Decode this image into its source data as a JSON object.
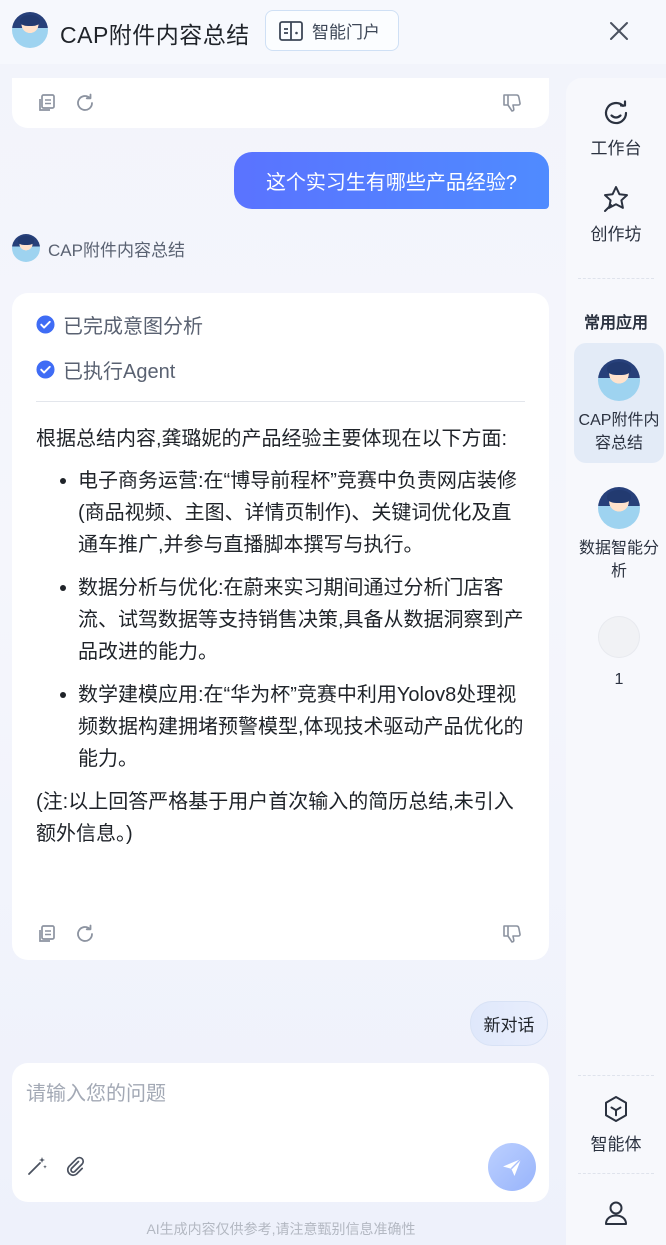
{
  "header": {
    "title": "CAP附件内容总结",
    "portal_label": "智能门户"
  },
  "sidebar": {
    "workbench_label": "工作台",
    "creation_label": "创作坊",
    "common_apps_heading": "常用应用",
    "apps": [
      {
        "label": "CAP附件内容总结",
        "active": true
      },
      {
        "label": "数据智能分析",
        "active": false
      },
      {
        "label": "1",
        "active": false
      }
    ],
    "agent_label": "智能体"
  },
  "chat": {
    "user_message": "这个实习生有哪些产品经验?",
    "bot_name": "CAP附件内容总结",
    "status_items": [
      "已完成意图分析",
      "已执行Agent"
    ],
    "answer_intro": "根据总结内容,龚璐妮的产品经验主要体现在以下方面:",
    "answer_points": [
      "电子商务运营:在“博导前程杯”竞赛中负责网店装修(商品视频、主图、详情页制作)、关键词优化及直通车推广,并参与直播脚本撰写与执行。",
      "数据分析与优化:在蔚来实习期间通过分析门店客流、试驾数据等支持销售决策,具备从数据洞察到产品改进的能力。",
      "数学建模应用:在“华为杯”竞赛中利用Yolov8处理视频数据构建拥堵预警模型,体现技术驱动产品优化的能力。"
    ],
    "answer_note": "(注:以上回答严格基于用户首次输入的简历总结,未引入额外信息。)",
    "new_chat_label": "新对话"
  },
  "input": {
    "placeholder": "请输入您的问题",
    "value": ""
  },
  "footer": {
    "disclaimer": "AI生成内容仅供参考,请注意甄别信息准确性"
  },
  "colors": {
    "accent": "#5a73ff",
    "check": "#3f6cf5",
    "active_tile": "#e3ebf7"
  }
}
